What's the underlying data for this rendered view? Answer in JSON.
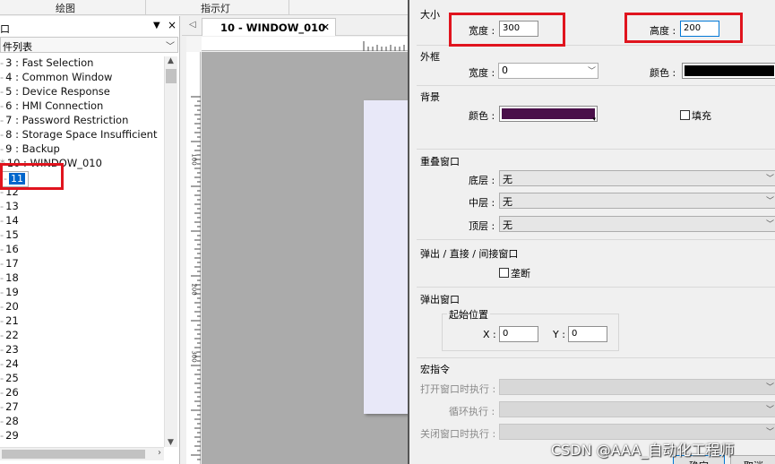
{
  "topbar": {
    "tab1": "绘图",
    "tab2": "指示灯"
  },
  "left_panel": {
    "title": "口",
    "pin_icon": "dropdown-arrow",
    "close_icon": "×",
    "combo_value": "件列表",
    "items": [
      "3 : Fast Selection",
      "4 : Common Window",
      "5 : Device Response",
      "6 : HMI Connection",
      "7 : Password Restriction",
      "8 : Storage Space Insufficient",
      "9 : Backup",
      "10 : WINDOW_010",
      "11",
      "12",
      "13",
      "14",
      "15",
      "16",
      "17",
      "18",
      "19",
      "20",
      "21",
      "22",
      "23",
      "24",
      "25",
      "26",
      "27",
      "28",
      "29"
    ],
    "item_prefixes": [
      "",
      "",
      "",
      "",
      "",
      "",
      "",
      "*",
      "",
      "",
      "",
      "",
      "",
      "",
      "",
      "",
      "",
      "",
      "",
      "",
      "",
      "",
      "",
      "",
      "",
      "",
      ""
    ],
    "selected_index": 8
  },
  "editor": {
    "tab_title": "10 - WINDOW_010",
    "ruler_marks": [
      "100",
      "200",
      "300"
    ]
  },
  "dialog": {
    "size_group": "大小",
    "width_label": "宽度 :",
    "width_value": "300",
    "height_label": "高度 :",
    "height_value": "200",
    "border_group": "外框",
    "border_width_label": "宽度 :",
    "border_width_value": "0",
    "border_color_label": "颜色 :",
    "border_color": "#000000",
    "bg_group": "背景",
    "bg_color_label": "颜色 :",
    "bg_color": "#4a0f4a",
    "fill_label": "填充",
    "overlap_group": "重叠窗口",
    "bottom_label": "底层 :",
    "bottom_value": "无",
    "middle_label": "中层 :",
    "middle_value": "无",
    "top_label": "顶层 :",
    "top_value": "无",
    "popup_group": "弹出 / 直接 / 间接窗口",
    "exclusive_label": "垄断",
    "popup_win_group": "弹出窗口",
    "start_pos_label": "起始位置",
    "x_label": "X :",
    "x_value": "0",
    "y_label": "Y :",
    "y_value": "0",
    "macro_group": "宏指令",
    "open_macro_label": "打开窗口时执行 :",
    "loop_macro_label": "循环执行 :",
    "close_macro_label": "关闭窗口时执行 :",
    "ok_label": "确定",
    "cancel_label": "取消"
  },
  "watermark": "CSDN @AAA_自动化工程师",
  "colors": {
    "highlight": "#e0141e",
    "selection": "#0066cc"
  }
}
